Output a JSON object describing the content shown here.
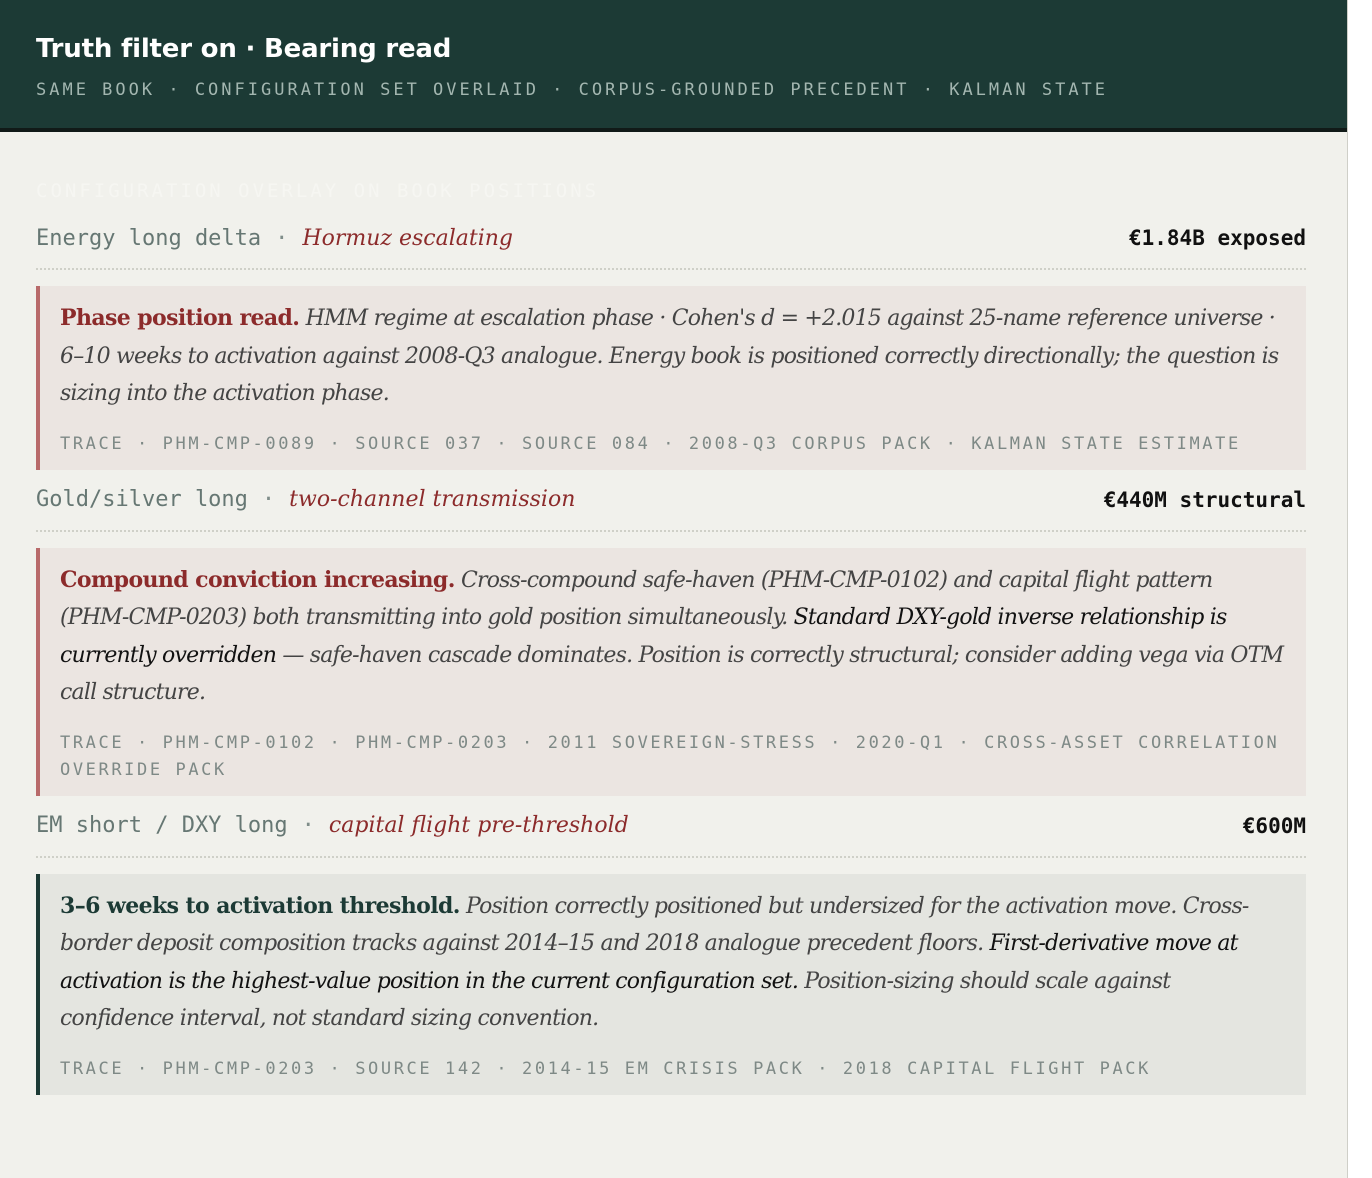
{
  "header": {
    "title": "Truth filter on · Bearing read",
    "subtitle": "SAME BOOK · CONFIGURATION SET OVERLAID · CORPUS-GROUNDED PRECEDENT · KALMAN STATE"
  },
  "section_label": "CONFIGURATION OVERLAY ON BOOK POSITIONS",
  "positions": [
    {
      "name": "Energy long delta",
      "separator": "·",
      "regime": "Hormuz escalating",
      "exposure": "€1.84B exposed",
      "read": {
        "lead": "Phase position read.",
        "text_1": " HMM regime at escalation phase · Cohen's d = +2.015 against 25-name reference universe · 6–10 weeks to activation against 2008-Q3 analogue. Energy book is positioned correctly directionally; the question is sizing into the activation phase.",
        "emphasis": "",
        "text_2": "",
        "trace": "TRACE · PHM-CMP-0089 · SOURCE 037 · SOURCE 084 · 2008-Q3 CORPUS PACK · KALMAN STATE ESTIMATE"
      }
    },
    {
      "name": "Gold/silver long",
      "separator": "·",
      "regime": "two-channel transmission",
      "exposure": "€440M structural",
      "read": {
        "lead": "Compound conviction increasing.",
        "text_1": " Cross-compound safe-haven (PHM-CMP-0102) and capital flight pattern (PHM-CMP-0203) both transmitting into gold position simultaneously. ",
        "emphasis": "Standard DXY-gold inverse relationship is currently overridden",
        "text_2": " — safe-haven cascade dominates. Position is correctly structural; consider adding vega via OTM call structure.",
        "trace": "TRACE · PHM-CMP-0102 · PHM-CMP-0203 · 2011 SOVEREIGN-STRESS · 2020-Q1 · CROSS-ASSET CORRELATION OVERRIDE PACK"
      }
    },
    {
      "name": "EM short / DXY long",
      "separator": "·",
      "regime": "capital flight pre-threshold",
      "exposure": "€600M",
      "read": {
        "lead": "3–6 weeks to activation threshold.",
        "text_1": " Position correctly positioned but undersized for the activation move. Cross-border deposit composition tracks against 2014–15 and 2018 analogue precedent floors. ",
        "emphasis": "First-derivative move at activation is the highest-value position in the current configuration set.",
        "text_2": " Position-sizing should scale against confidence interval, not standard sizing convention.",
        "trace": "TRACE · PHM-CMP-0203 · SOURCE 142 · 2014-15 EM CRISIS PACK · 2018 CAPITAL FLIGHT PACK"
      }
    }
  ],
  "colors": {
    "header_bg": "#1c3a35",
    "accent_red": "#8c2b2b",
    "page_bg": "#f1f1ec"
  }
}
